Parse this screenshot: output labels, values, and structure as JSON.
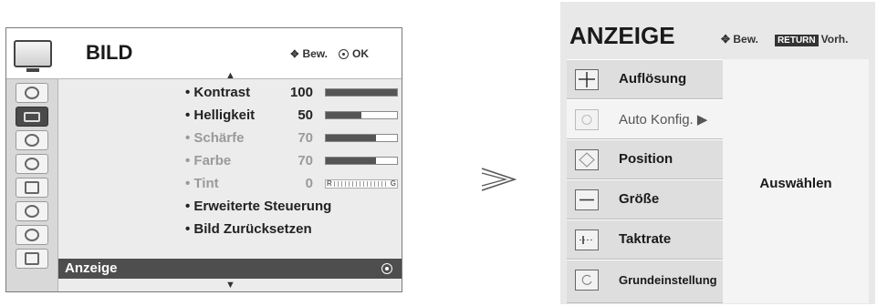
{
  "bild": {
    "title": "BILD",
    "hint_move": "Bew.",
    "hint_ok": "OK",
    "rail_icons": [
      "tv-icon",
      "picture-icon",
      "screen-icon",
      "audio-icon",
      "time-icon",
      "options-icon",
      "lock-icon",
      "input-icon",
      "usb-icon"
    ],
    "rows": [
      {
        "label": "• Kontrast",
        "value": "100",
        "level": 1.0,
        "dim": false
      },
      {
        "label": "• Helligkeit",
        "value": "50",
        "level": 0.5,
        "dim": false
      },
      {
        "label": "• Schärfe",
        "value": "70",
        "level": 0.7,
        "dim": true
      },
      {
        "label": "• Farbe",
        "value": "70",
        "level": 0.7,
        "dim": true
      },
      {
        "label": "• Tint",
        "value": "0",
        "tint_left": "R",
        "tint_right": "G",
        "dim": true
      }
    ],
    "extra_rows": [
      "• Erweiterte Steuerung",
      "• Bild Zurücksetzen"
    ],
    "selected": "Anzeige"
  },
  "anzeige": {
    "title": "ANZEIGE",
    "hint_move": "Bew.",
    "hint_return": "RETURN",
    "hint_prev": "Vorh.",
    "items": [
      {
        "label": "Auflösung",
        "icon": "crosshair-icon"
      },
      {
        "label": "Auto Konfig. ▶",
        "icon": "auto-config-icon",
        "active": true
      },
      {
        "label": "Position",
        "icon": "position-icon"
      },
      {
        "label": "Größe",
        "icon": "size-icon"
      },
      {
        "label": "Taktrate",
        "icon": "clock-rate-icon"
      },
      {
        "label": "Grundeinstellung",
        "icon": "reset-icon",
        "small": true
      }
    ],
    "panel_text": "Auswählen"
  },
  "colors": {
    "selected_row": "#4e4e4e",
    "panel_bg": "#e8e8e8"
  }
}
